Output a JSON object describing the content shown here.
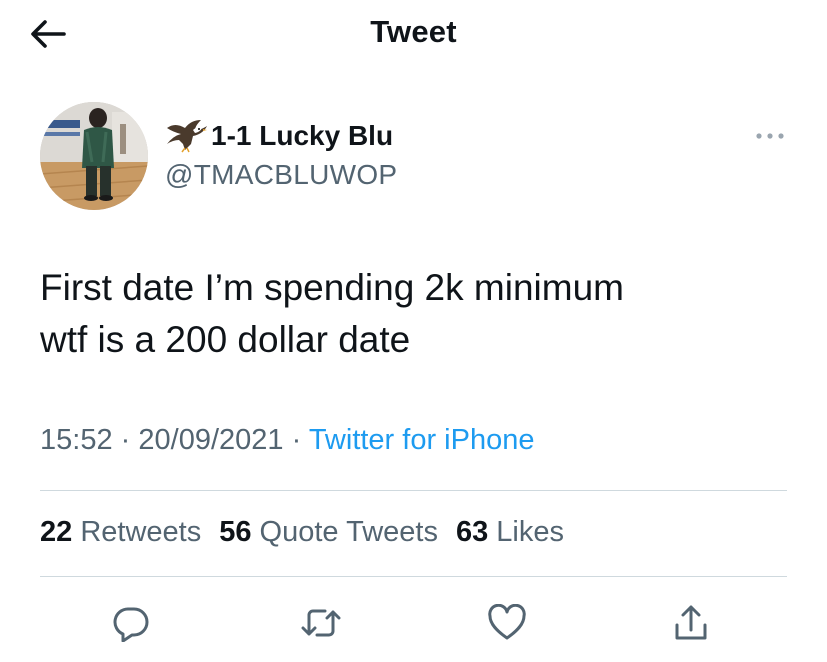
{
  "header": {
    "title": "Tweet",
    "back_icon": "arrow-left-icon"
  },
  "author": {
    "display_name": "1-1 Lucky Blu",
    "handle": "@TMACBLUWOP",
    "name_emoji": "eagle-icon"
  },
  "tweet": {
    "text_lines": [
      "First date I’m spending 2k minimum",
      "wtf is a 200 dollar date"
    ],
    "time": "15:52",
    "date": "20/09/2021",
    "separator": "·",
    "source": "Twitter for iPhone"
  },
  "stats": {
    "retweets_count": "22",
    "retweets_label": "Retweets",
    "quote_count": "56",
    "quote_label": "Quote Tweets",
    "likes_count": "63",
    "likes_label": "Likes"
  },
  "actions": [
    "reply-icon",
    "retweet-icon",
    "like-icon",
    "share-icon"
  ],
  "colors": {
    "text_primary": "#0f1419",
    "text_secondary": "#536471",
    "link": "#1d9bf0",
    "divider": "#cfd9de"
  }
}
